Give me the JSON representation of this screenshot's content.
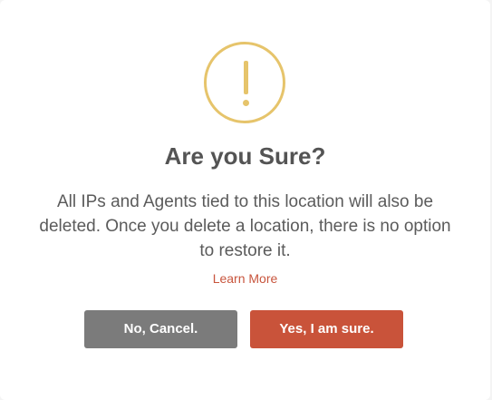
{
  "dialog": {
    "icon": "warning-exclamation-icon",
    "title": "Are you Sure?",
    "message": "All IPs and Agents tied to this location will also be deleted. Once you delete a location, there is no option to restore it.",
    "learn_more": "Learn More",
    "cancel_label": "No, Cancel.",
    "confirm_label": "Yes, I am sure."
  },
  "colors": {
    "icon": "#e6c46b",
    "cancel_button": "#7b7b7b",
    "confirm_button": "#c9533a",
    "link": "#c8553d"
  }
}
